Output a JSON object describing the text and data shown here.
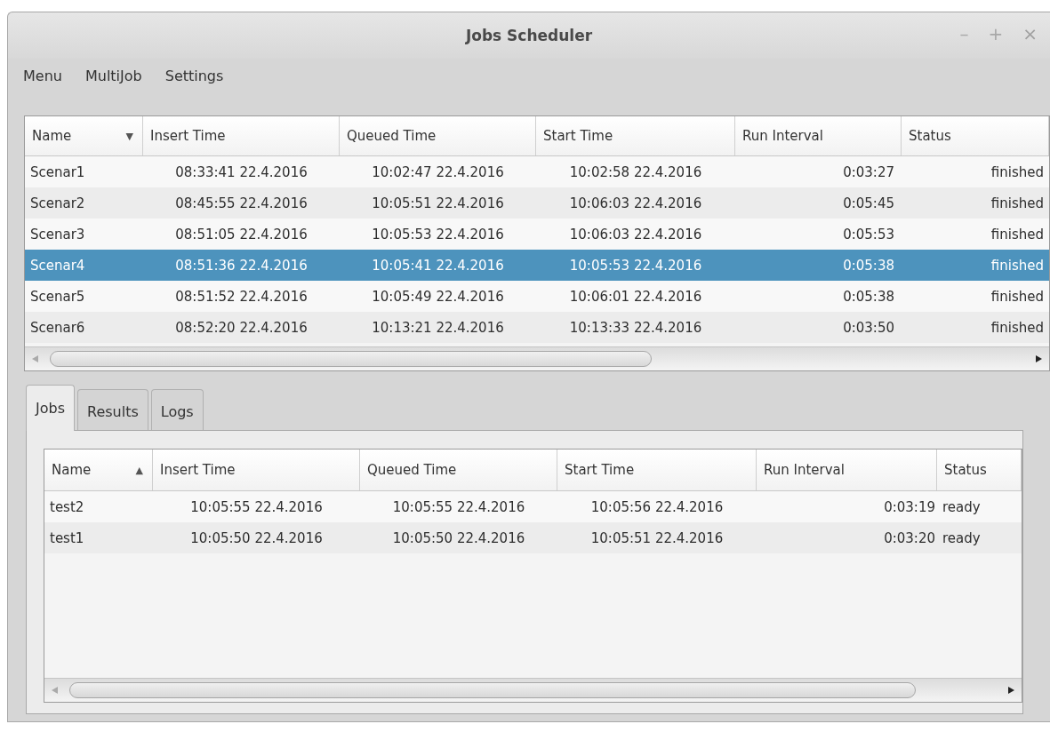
{
  "window": {
    "title": "Jobs Scheduler",
    "controls": [
      {
        "kind": "minimize",
        "label": "–"
      },
      {
        "kind": "maximize",
        "label": "+"
      },
      {
        "kind": "close",
        "label": "×"
      }
    ]
  },
  "menu": [
    "Menu",
    "MultiJob",
    "Settings"
  ],
  "scenarios": {
    "columns": [
      {
        "label": "Name",
        "sort_indicator": "▼"
      },
      {
        "label": "Insert Time"
      },
      {
        "label": "Queued Time"
      },
      {
        "label": "Start Time"
      },
      {
        "label": "Run Interval"
      },
      {
        "label": "Status"
      }
    ],
    "rows": [
      {
        "selected": false,
        "cells": [
          "Scenar1",
          "08:33:41 22.4.2016",
          "10:02:47 22.4.2016",
          "10:02:58 22.4.2016",
          "0:03:27",
          "finished"
        ]
      },
      {
        "selected": false,
        "cells": [
          "Scenar2",
          "08:45:55 22.4.2016",
          "10:05:51 22.4.2016",
          "10:06:03 22.4.2016",
          "0:05:45",
          "finished"
        ]
      },
      {
        "selected": false,
        "cells": [
          "Scenar3",
          "08:51:05 22.4.2016",
          "10:05:53 22.4.2016",
          "10:06:03 22.4.2016",
          "0:05:53",
          "finished"
        ]
      },
      {
        "selected": true,
        "cells": [
          "Scenar4",
          "08:51:36 22.4.2016",
          "10:05:41 22.4.2016",
          "10:05:53 22.4.2016",
          "0:05:38",
          "finished"
        ]
      },
      {
        "selected": false,
        "cells": [
          "Scenar5",
          "08:51:52 22.4.2016",
          "10:05:49 22.4.2016",
          "10:06:01 22.4.2016",
          "0:05:38",
          "finished"
        ]
      },
      {
        "selected": false,
        "cells": [
          "Scenar6",
          "08:52:20 22.4.2016",
          "10:13:21 22.4.2016",
          "10:13:33 22.4.2016",
          "0:03:50",
          "finished"
        ]
      }
    ]
  },
  "tabs": [
    {
      "label": "Jobs",
      "selected": true
    },
    {
      "label": "Results",
      "selected": false
    },
    {
      "label": "Logs",
      "selected": false
    }
  ],
  "jobs": {
    "columns": [
      {
        "label": "Name",
        "sort_indicator": "▲"
      },
      {
        "label": "Insert Time"
      },
      {
        "label": "Queued Time"
      },
      {
        "label": "Start Time"
      },
      {
        "label": "Run Interval"
      },
      {
        "label": "Status"
      }
    ],
    "rows": [
      {
        "selected": false,
        "cells": [
          "test2",
          "10:05:55 22.4.2016",
          "10:05:55 22.4.2016",
          "10:05:56 22.4.2016",
          "0:03:19",
          "ready"
        ]
      },
      {
        "selected": false,
        "cells": [
          "test1",
          "10:05:50 22.4.2016",
          "10:05:50 22.4.2016",
          "10:05:51 22.4.2016",
          "0:03:20",
          "ready"
        ]
      }
    ]
  }
}
